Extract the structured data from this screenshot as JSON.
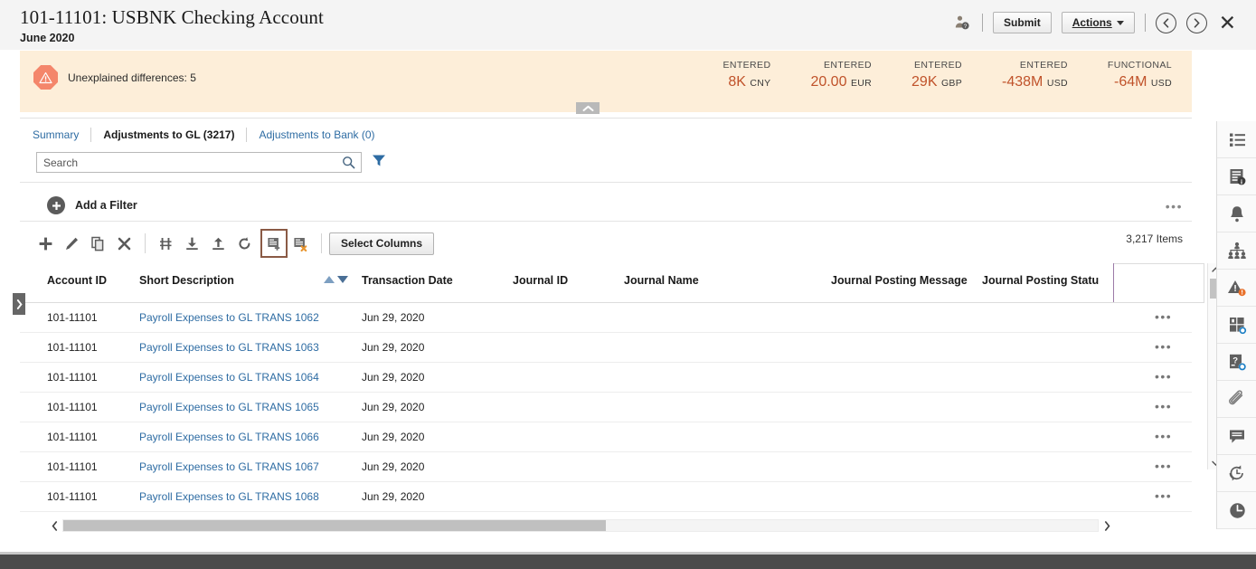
{
  "header": {
    "account_title": "101-11101: USBNK Checking Account",
    "period": "June 2020",
    "user_icon": "user-badge-icon",
    "submit_label": "Submit",
    "actions_label": "Actions",
    "prev_icon": "chevron-left-circle-icon",
    "next_icon": "chevron-right-circle-icon",
    "close_icon": "close-icon"
  },
  "banner": {
    "warning_icon": "warning-octagon-icon",
    "warning_text": "Unexplained differences: 5",
    "collapse_icon": "chevron-up-icon",
    "background_color": "#fdeed9",
    "accent_color": "#c0522a",
    "totals": [
      {
        "label": "ENTERED",
        "value": "8K",
        "currency": "CNY"
      },
      {
        "label": "ENTERED",
        "value": "20.00",
        "currency": "EUR"
      },
      {
        "label": "ENTERED",
        "value": "29K",
        "currency": "GBP"
      },
      {
        "label": "ENTERED",
        "value": "-438M",
        "currency": "USD"
      },
      {
        "label": "FUNCTIONAL",
        "value": "-64M",
        "currency": "USD"
      }
    ]
  },
  "tabs": [
    {
      "label": "Summary",
      "active": false
    },
    {
      "label": "Adjustments to GL (3217)",
      "active": true
    },
    {
      "label": "Adjustments to Bank (0)",
      "active": false
    }
  ],
  "search": {
    "value": "",
    "placeholder": "Search",
    "search_icon": "search-icon",
    "filter_icon": "funnel-filter-icon"
  },
  "filter_bar": {
    "add_filter_label": "Add a Filter",
    "plus_icon": "plus-circle-icon",
    "overflow_icon": "ellipsis-icon"
  },
  "toolbar": {
    "icons": [
      {
        "name": "add-icon",
        "highlighted": false
      },
      {
        "name": "edit-pencil-icon",
        "highlighted": false
      },
      {
        "name": "duplicate-icon",
        "highlighted": false
      },
      {
        "name": "delete-x-icon",
        "highlighted": false
      },
      {
        "name": "split-icon",
        "highlighted": false
      },
      {
        "name": "download-icon",
        "highlighted": false
      },
      {
        "name": "upload-icon",
        "highlighted": false
      },
      {
        "name": "refresh-icon",
        "highlighted": false
      },
      {
        "name": "add-journal-icon",
        "highlighted": true
      },
      {
        "name": "remove-journal-icon",
        "highlighted": false
      }
    ],
    "select_columns_label": "Select Columns",
    "highlight_color": "#8a5a45",
    "items_count": "3,217 Items"
  },
  "table": {
    "columns": [
      "Account ID",
      "Short Description",
      "Transaction Date",
      "Journal ID",
      "Journal Name",
      "Journal Posting Message",
      "Journal Posting Statu"
    ],
    "sort": {
      "column": "Transaction Date",
      "asc_icon": "sort-ascending-icon",
      "desc_icon": "sort-descending-icon"
    },
    "row_menu_icon": "ellipsis-icon",
    "rows": [
      {
        "account_id": "101-11101",
        "short_description": "Payroll Expenses to GL TRANS 1062",
        "transaction_date": "Jun 29, 2020",
        "journal_id": "",
        "journal_name": "",
        "journal_posting_message": "",
        "journal_posting_status": ""
      },
      {
        "account_id": "101-11101",
        "short_description": "Payroll Expenses to GL TRANS 1063",
        "transaction_date": "Jun 29, 2020",
        "journal_id": "",
        "journal_name": "",
        "journal_posting_message": "",
        "journal_posting_status": ""
      },
      {
        "account_id": "101-11101",
        "short_description": "Payroll Expenses to GL TRANS 1064",
        "transaction_date": "Jun 29, 2020",
        "journal_id": "",
        "journal_name": "",
        "journal_posting_message": "",
        "journal_posting_status": ""
      },
      {
        "account_id": "101-11101",
        "short_description": "Payroll Expenses to GL TRANS 1065",
        "transaction_date": "Jun 29, 2020",
        "journal_id": "",
        "journal_name": "",
        "journal_posting_message": "",
        "journal_posting_status": ""
      },
      {
        "account_id": "101-11101",
        "short_description": "Payroll Expenses to GL TRANS 1066",
        "transaction_date": "Jun 29, 2020",
        "journal_id": "",
        "journal_name": "",
        "journal_posting_message": "",
        "journal_posting_status": ""
      },
      {
        "account_id": "101-11101",
        "short_description": "Payroll Expenses to GL TRANS 1067",
        "transaction_date": "Jun 29, 2020",
        "journal_id": "",
        "journal_name": "",
        "journal_posting_message": "",
        "journal_posting_status": ""
      },
      {
        "account_id": "101-11101",
        "short_description": "Payroll Expenses to GL TRANS 1068",
        "transaction_date": "Jun 29, 2020",
        "journal_id": "",
        "journal_name": "",
        "journal_posting_message": "",
        "journal_posting_status": ""
      }
    ]
  },
  "scrollbars": {
    "vertical_up_icon": "chevron-up-icon",
    "vertical_down_icon": "chevron-down-icon",
    "horizontal_left_icon": "chevron-left-icon",
    "horizontal_right_icon": "chevron-right-icon"
  },
  "left_panel_handle": {
    "icon": "chevron-right-icon"
  },
  "right_rail": [
    {
      "name": "list-icon"
    },
    {
      "name": "document-info-icon"
    },
    {
      "name": "bell-icon"
    },
    {
      "name": "org-hierarchy-icon"
    },
    {
      "name": "alert-warning-icon"
    },
    {
      "name": "dashboard-icon"
    },
    {
      "name": "question-info-icon"
    },
    {
      "name": "paperclip-icon"
    },
    {
      "name": "comment-icon"
    },
    {
      "name": "history-refresh-icon"
    },
    {
      "name": "clock-icon"
    }
  ]
}
